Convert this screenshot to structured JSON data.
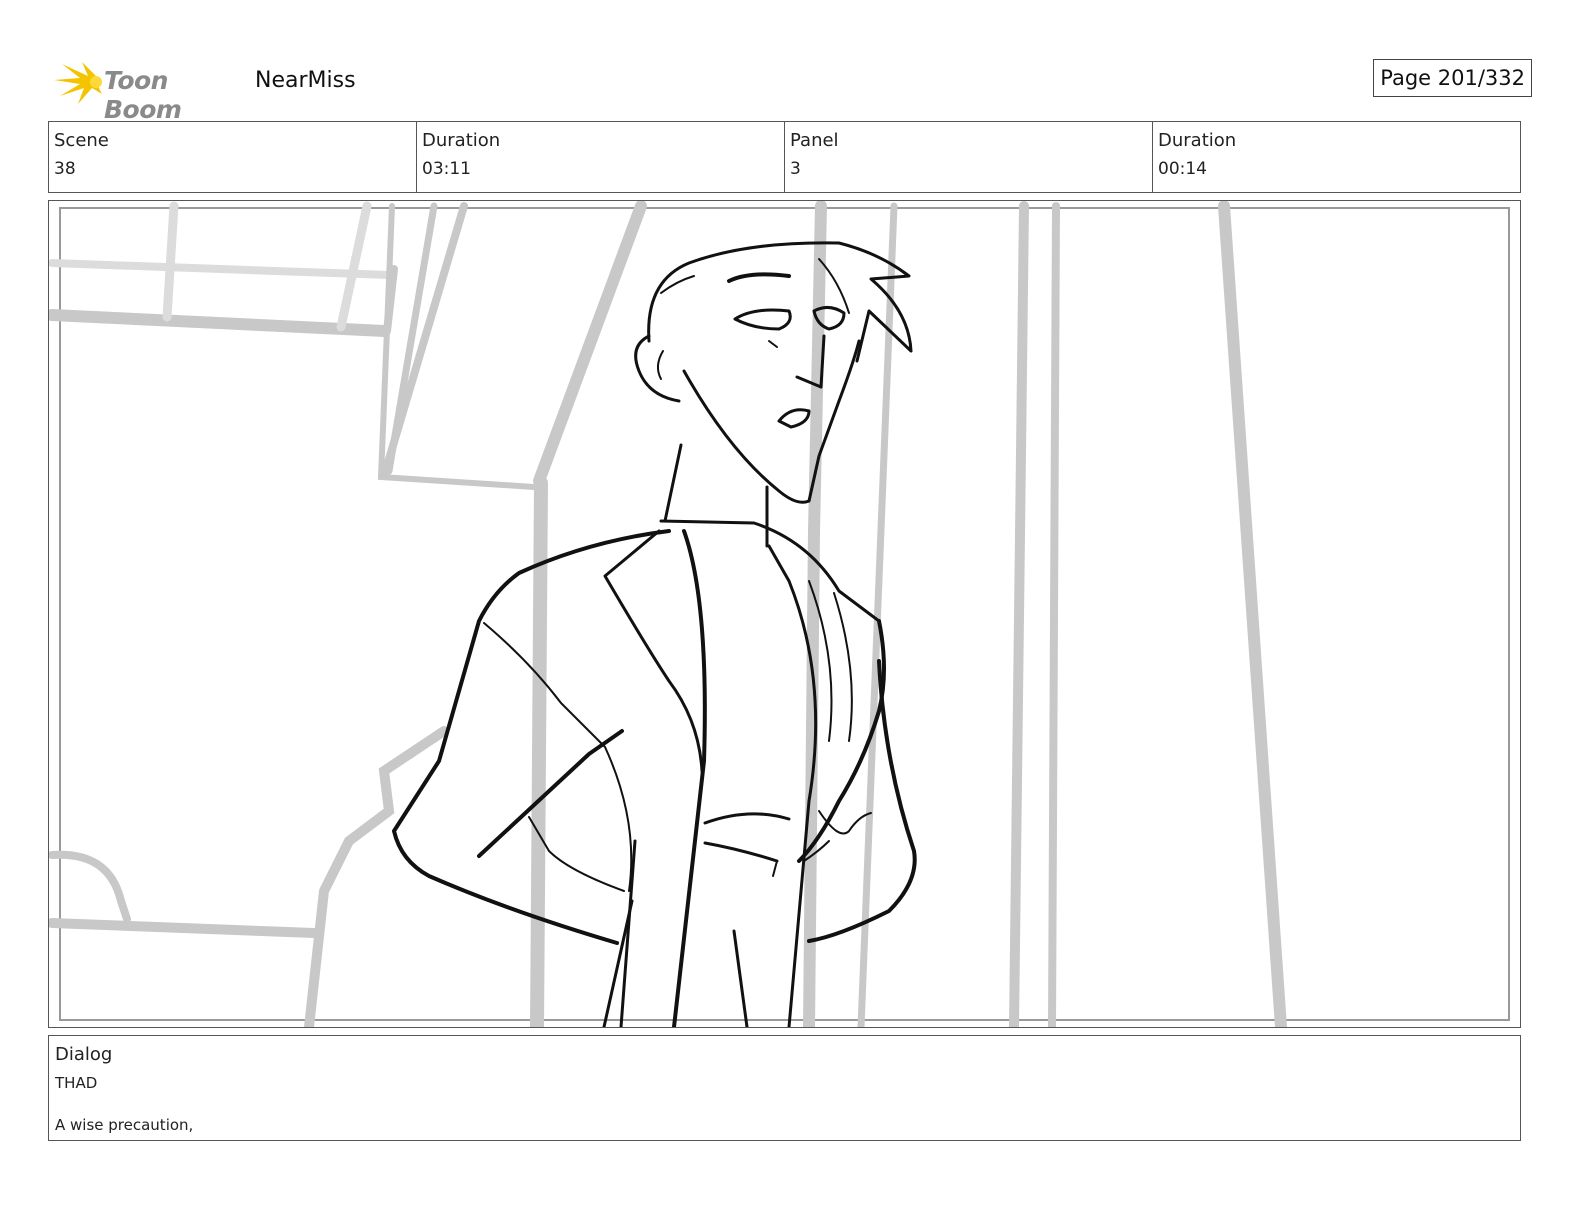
{
  "header": {
    "logo_text": "Toon Boom",
    "project_name": "NearMiss",
    "page_label": "Page 201/332"
  },
  "info": {
    "scene_label": "Scene",
    "scene_value": "38",
    "scene_duration_label": "Duration",
    "scene_duration_value": "03:11",
    "panel_label": "Panel",
    "panel_value": "3",
    "panel_duration_label": "Duration",
    "panel_duration_value": "00:14"
  },
  "dialog": {
    "label": "Dialog",
    "speaker": "THAD",
    "line": "A wise precaution,"
  },
  "colors": {
    "logo_star": "#f5c400",
    "background_lines": "#c8c8c8",
    "character_lines": "#111111",
    "border": "#555555"
  }
}
